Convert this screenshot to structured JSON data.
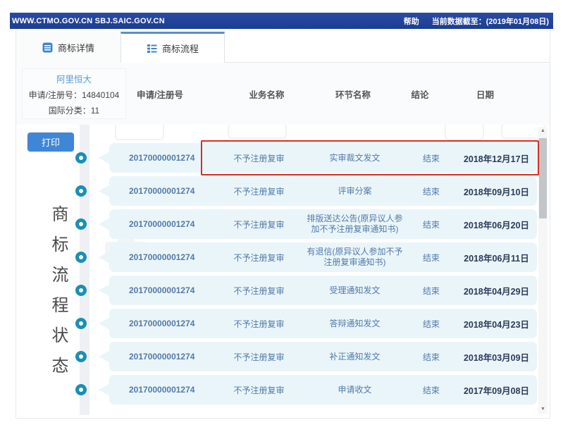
{
  "topbar": {
    "site": "WWW.CTMO.GOV.CN SBJ.SAIC.GOV.CN",
    "help": "帮助",
    "data_asof": "当前数据截至：(2019年01月08日)"
  },
  "tabs": [
    {
      "label": "商标详情",
      "active": false
    },
    {
      "label": "商标流程",
      "active": true
    }
  ],
  "info": {
    "name": "阿里恒大",
    "reg_no": "申请/注册号：14840104",
    "intl_class": "国际分类：11"
  },
  "print_label": "打印",
  "side_label": "商标流程状态",
  "table": {
    "headers": [
      "申请/注册号",
      "业务名称",
      "环节名称",
      "结论",
      "日期"
    ],
    "rows": [
      {
        "no": "20170000001274",
        "business": "不予注册复审",
        "step": "实审裁文发文",
        "result": "结束",
        "date": "2018年12月17日",
        "highlight": true
      },
      {
        "no": "20170000001274",
        "business": "不予注册复审",
        "step": "评审分案",
        "result": "结束",
        "date": "2018年09月10日",
        "highlight": false
      },
      {
        "no": "20170000001274",
        "business": "不予注册复审",
        "step": "排版送达公告(原异议人参加不予注册复审通知书)",
        "result": "结束",
        "date": "2018年06月20日",
        "highlight": false
      },
      {
        "no": "20170000001274",
        "business": "不予注册复审",
        "step": "有退信(原异议人参加不予注册复审通知书)",
        "result": "结束",
        "date": "2018年06月11日",
        "highlight": false
      },
      {
        "no": "20170000001274",
        "business": "不予注册复审",
        "step": "受理通知发文",
        "result": "结束",
        "date": "2018年04月29日",
        "highlight": false
      },
      {
        "no": "20170000001274",
        "business": "不予注册复审",
        "step": "答辩通知发文",
        "result": "结束",
        "date": "2018年04月23日",
        "highlight": false
      },
      {
        "no": "20170000001274",
        "business": "不予注册复审",
        "step": "补正通知发文",
        "result": "结束",
        "date": "2018年03月09日",
        "highlight": false
      },
      {
        "no": "20170000001274",
        "business": "不予注册复审",
        "step": "申请收文",
        "result": "结束",
        "date": "2017年09月08日",
        "highlight": false
      }
    ]
  },
  "icons": {
    "tab_details": "document-icon",
    "tab_process": "list-icon",
    "scroll_up": "▲",
    "scroll_down": "▼"
  },
  "colors": {
    "topbar": "#1b3d92",
    "tab_accent": "#5b8fc7",
    "icon_blue": "#3d85c8",
    "print_button": "#3f86d6",
    "timeline_ring": "#1a8fb4",
    "bubble_bg": "#eaf5f9",
    "row_text": "#527aab",
    "date_text": "#2b3a5c",
    "highlight_border": "#dd2b1c"
  }
}
